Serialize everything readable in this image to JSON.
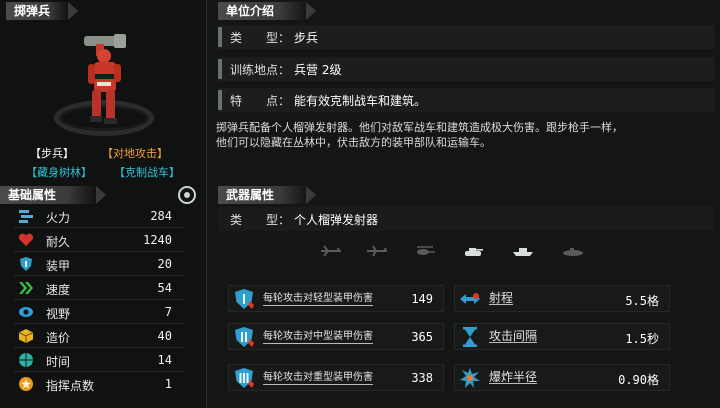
{
  "unit": {
    "name": "掷弹兵",
    "tags": {
      "tag1": "【步兵】",
      "tag2": "【对地攻击】",
      "tag3": "【藏身树林】",
      "tag4": "【克制战车】"
    }
  },
  "base_stats": {
    "title": "基础属性",
    "rows": [
      {
        "label": "火力",
        "value": "284",
        "icon": "firepower-icon"
      },
      {
        "label": "耐久",
        "value": "1240",
        "icon": "heart-icon"
      },
      {
        "label": "装甲",
        "value": "20",
        "icon": "armor-shield-icon"
      },
      {
        "label": "速度",
        "value": "54",
        "icon": "speed-chevron-icon"
      },
      {
        "label": "视野",
        "value": "7",
        "icon": "eye-icon"
      },
      {
        "label": "造价",
        "value": "40",
        "icon": "cost-box-icon"
      },
      {
        "label": "时间",
        "value": "14",
        "icon": "time-globe-icon"
      },
      {
        "label": "指挥点数",
        "value": "1",
        "icon": "command-star-icon"
      }
    ]
  },
  "intro": {
    "title": "单位介绍",
    "type_key": "类　　型：",
    "type_val": "步兵",
    "location_key": "训练地点：",
    "location_val": "兵营 2级",
    "feature_key": "特　　点：",
    "feature_val": "能有效克制战车和建筑。",
    "desc_line1": "掷弹兵配备个人榴弹发射器。他们对敌军战车和建筑造成极大伤害。跟步枪手一样，",
    "desc_line2": "他们可以隐藏在丛林中，伏击敌方的装甲部队和运输车。"
  },
  "weapon": {
    "title": "武器属性",
    "type_key": "类　　型：",
    "type_val": "个人榴弹发射器",
    "targets": [
      "aircraft",
      "plane",
      "helicopter",
      "tank",
      "ship",
      "submarine"
    ],
    "stats": {
      "light": {
        "label": "每轮攻击对轻型装甲伤害",
        "value": "149"
      },
      "medium": {
        "label": "每轮攻击对中型装甲伤害",
        "value": "365"
      },
      "heavy": {
        "label": "每轮攻击对重型装甲伤害",
        "value": "338"
      },
      "range": {
        "label": "射程",
        "value": "5.5格"
      },
      "interval": {
        "label": "攻击间隔",
        "value": "1.5秒"
      },
      "radius": {
        "label": "爆炸半径",
        "value": "0.90格"
      }
    }
  },
  "colors": {
    "orange": "#f0a13a",
    "cyan": "#32c3d7",
    "accent_blue": "#2f9fd0"
  }
}
